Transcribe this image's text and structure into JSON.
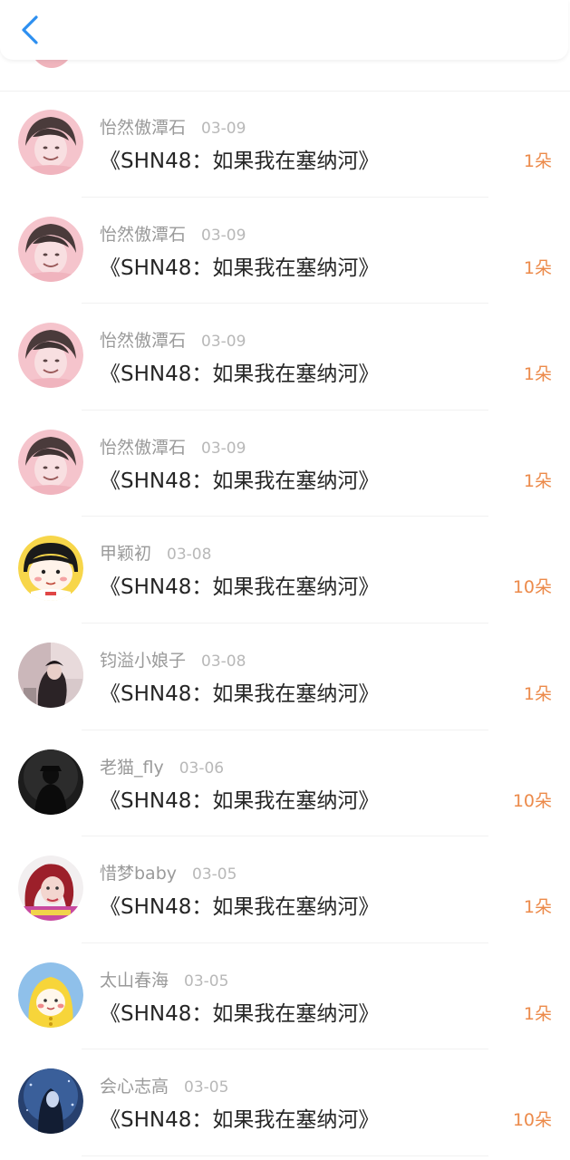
{
  "header": {
    "back_icon": "chevron-left-icon",
    "accent_color": "#2d8ff0"
  },
  "items": [
    {
      "user": "怡然傲潭石",
      "date": "03-09",
      "title": "《SHN48：如果我在塞纳河》",
      "count": "1朵",
      "avatar": "pink-boy-avatar"
    },
    {
      "user": "怡然傲潭石",
      "date": "03-09",
      "title": "《SHN48：如果我在塞纳河》",
      "count": "1朵",
      "avatar": "pink-boy-avatar"
    },
    {
      "user": "怡然傲潭石",
      "date": "03-09",
      "title": "《SHN48：如果我在塞纳河》",
      "count": "1朵",
      "avatar": "pink-boy-avatar"
    },
    {
      "user": "怡然傲潭石",
      "date": "03-09",
      "title": "《SHN48：如果我在塞纳河》",
      "count": "1朵",
      "avatar": "pink-boy-avatar"
    },
    {
      "user": "甲颖初",
      "date": "03-08",
      "title": "《SHN48：如果我在塞纳河》",
      "count": "10朵",
      "avatar": "cartoon-girl-avatar"
    },
    {
      "user": "钧溢小娘子",
      "date": "03-08",
      "title": "《SHN48：如果我在塞纳河》",
      "count": "1朵",
      "avatar": "couple-photo-avatar"
    },
    {
      "user": "老猫_fly",
      "date": "03-06",
      "title": "《SHN48：如果我在塞纳河》",
      "count": "10朵",
      "avatar": "dark-silhouette-avatar"
    },
    {
      "user": "惜梦baby",
      "date": "03-05",
      "title": "《SHN48：如果我在塞纳河》",
      "count": "1朵",
      "avatar": "red-hair-girl-avatar"
    },
    {
      "user": "太山春海",
      "date": "03-05",
      "title": "《SHN48：如果我在塞纳河》",
      "count": "1朵",
      "avatar": "yellow-raincoat-avatar"
    },
    {
      "user": "会心志高",
      "date": "03-05",
      "title": "《SHN48：如果我在塞纳河》",
      "count": "10朵",
      "avatar": "blue-night-avatar"
    }
  ]
}
